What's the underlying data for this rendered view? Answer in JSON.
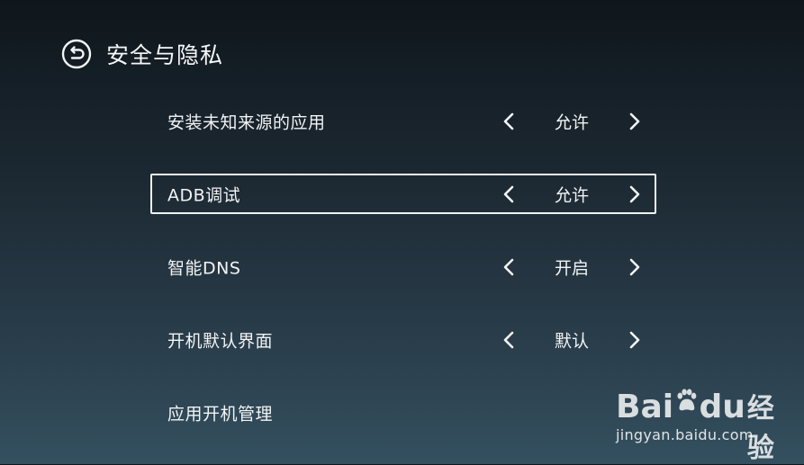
{
  "header": {
    "title": "安全与隐私",
    "back_icon": "back-arrow-circle-icon"
  },
  "settings": [
    {
      "label": "安装未知来源的应用",
      "value": "允许",
      "focused": false
    },
    {
      "label": "ADB调试",
      "value": "允许",
      "focused": true
    },
    {
      "label": "智能DNS",
      "value": "开启",
      "focused": false
    },
    {
      "label": "开机默认界面",
      "value": "默认",
      "focused": false
    },
    {
      "label": "应用开机管理",
      "value": "",
      "focused": false
    }
  ],
  "watermark": {
    "brand_left": "Bai",
    "brand_right": "du",
    "suffix": "经验",
    "url": "jingyan.baidu.com"
  },
  "colors": {
    "text": "#f2f4f5",
    "focus_border": "#f0f2f3",
    "background_top": "#0f161c",
    "background_bottom": "#34505f"
  }
}
